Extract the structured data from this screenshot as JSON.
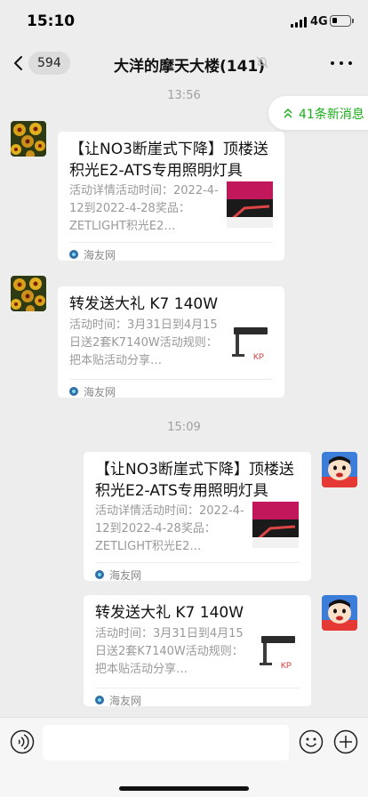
{
  "status_bar": {
    "time": "15:10",
    "network": "4G"
  },
  "nav": {
    "unread_count": "594",
    "title": "大洋的摩天大楼(141)"
  },
  "new_messages_label": "41条新消息",
  "timestamps": [
    "13:56",
    "15:09"
  ],
  "messages": [
    {
      "sender": "other",
      "title": "【让NO3断崖式下降】顶楼送积光E2-ATS专用照明灯具",
      "desc": "活动详情活动时间：2022-4-12到2022-4-28奖品：ZETLIGHT积光E2…",
      "source": "海友网",
      "thumb_caption": "NO3断崖\n50%下降"
    },
    {
      "sender": "other",
      "title": "转发送大礼 K7 140W",
      "desc": "活动时间：3月31日到4月15日送2套K7140W活动规则：把本贴活动分享…",
      "source": "海友网"
    },
    {
      "sender": "self",
      "title": "【让NO3断崖式下降】顶楼送积光E2-ATS专用照明灯具",
      "desc": "活动详情活动时间：2022-4-12到2022-4-28奖品：ZETLIGHT积光E2…",
      "source": "海友网",
      "thumb_caption": "NO3断崖\n50%下降"
    },
    {
      "sender": "self",
      "title": "转发送大礼 K7 140W",
      "desc": "活动时间：3月31日到4月15日送2套K7140W活动规则：把本贴活动分享…",
      "source": "海友网"
    }
  ],
  "colors": {
    "accent_green": "#1aad19",
    "chat_bg": "#ededed",
    "thumb_magenta": "#c2185b"
  },
  "icons": [
    "back-chevron-icon",
    "mute-bell-icon",
    "more-dots-icon",
    "double-chevron-up-icon",
    "voice-icon",
    "emoji-icon",
    "plus-icon",
    "source-logo-icon"
  ]
}
